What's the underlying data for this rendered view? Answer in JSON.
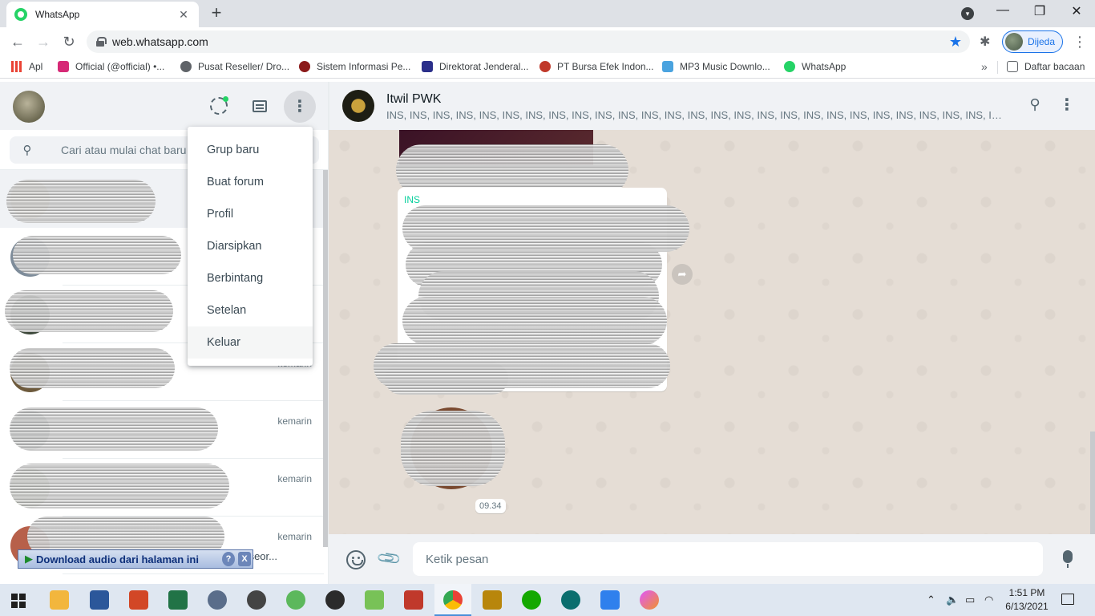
{
  "browser": {
    "tab_title": "WhatsApp",
    "tab_close": "✕",
    "new_tab": "+",
    "url": "web.whatsapp.com",
    "profile_label": "Dijeda",
    "win_minimize": "—",
    "win_restore": "❐",
    "win_close": "✕",
    "bookmarks": [
      {
        "label": "Apl",
        "color": "#ea4335"
      },
      {
        "label": "Official (@official) •...",
        "color": "#d62976"
      },
      {
        "label": "Pusat Reseller/ Dro...",
        "color": "#5f6368"
      },
      {
        "label": "Sistem Informasi Pe...",
        "color": "#8b1a1a"
      },
      {
        "label": "Direktorat Jenderal...",
        "color": "#2b2f8a"
      },
      {
        "label": "PT Bursa Efek Indon...",
        "color": "#c0392b"
      },
      {
        "label": "MP3 Music Downlo...",
        "color": "#4aa3df"
      },
      {
        "label": "WhatsApp",
        "color": "#25d366"
      }
    ],
    "reading_list": "Daftar bacaan"
  },
  "sidebar": {
    "search_placeholder": "Cari atau mulai chat baru",
    "chats": [
      {
        "time": "",
        "preview": ""
      },
      {
        "time": "",
        "preview": ""
      },
      {
        "time": "",
        "preview": ""
      },
      {
        "time": "kemarin",
        "preview": ""
      },
      {
        "time": "kemarin",
        "preview": ""
      },
      {
        "time": "kemarin",
        "preview": ""
      },
      {
        "time": "kemarin",
        "preview": "dak seor..."
      }
    ],
    "download_bar": {
      "label": "Download audio dari halaman ini",
      "help": "?",
      "close": "X"
    }
  },
  "menu": {
    "items": [
      "Grup baru",
      "Buat forum",
      "Profil",
      "Diarsipkan",
      "Berbintang",
      "Setelan",
      "Keluar"
    ]
  },
  "conversation": {
    "title": "Itwil PWK",
    "participants": "INS, INS, INS, INS, INS, INS, INS, INS, INS, INS, INS, INS, INS, INS, INS, INS, INS, INS, INS, INS, INS, INS, INS, INS, INS, INS, INS, INS, INS, INS, INS, INS, INS, INS, INS, I...",
    "card_link_text": "INS",
    "time_chip": "09.34",
    "input_placeholder": "Ketik pesan"
  },
  "taskbar": {
    "clock_time": "1:51 PM",
    "clock_date": "6/13/2021",
    "apps": [
      {
        "name": "file-explorer",
        "color": "#f2b63d"
      },
      {
        "name": "word",
        "color": "#2b579a"
      },
      {
        "name": "powerpoint",
        "color": "#d24726"
      },
      {
        "name": "excel",
        "color": "#217346"
      },
      {
        "name": "app-5",
        "color": "#5a6d8a"
      },
      {
        "name": "app-6",
        "color": "#444444"
      },
      {
        "name": "app-7",
        "color": "#5cb85c"
      },
      {
        "name": "obs",
        "color": "#2b2b2b"
      },
      {
        "name": "android-studio",
        "color": "#78c257"
      },
      {
        "name": "app-10",
        "color": "#c0392b"
      },
      {
        "name": "chrome",
        "color": "#4285f4"
      },
      {
        "name": "app-12",
        "color": "#b8860b"
      },
      {
        "name": "upwork",
        "color": "#14a800"
      },
      {
        "name": "app-14",
        "color": "#0b6e6e"
      },
      {
        "name": "app-15",
        "color": "#2f80ed"
      },
      {
        "name": "app-16",
        "color": "#e056fd"
      }
    ]
  }
}
